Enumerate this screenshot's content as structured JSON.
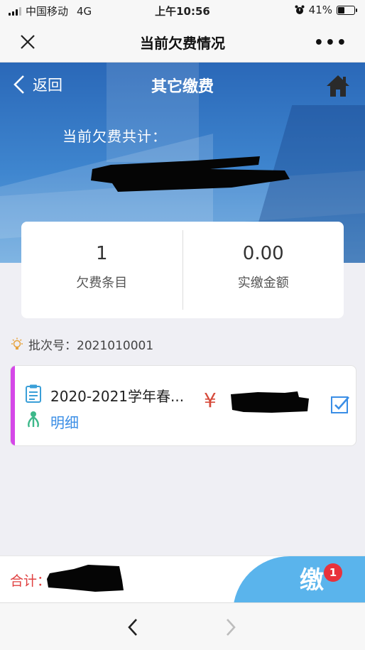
{
  "status_bar": {
    "carrier": "中国移动",
    "network": "4G",
    "time": "上午10:56",
    "battery_percent": "41%",
    "battery_level": 0.41
  },
  "wechat_nav": {
    "title": "当前欠费情况",
    "more_label": "•••",
    "close_icon": "close-icon",
    "more_icon": "more-dots-icon"
  },
  "header": {
    "back_label": "返回",
    "title": "其它缴费",
    "home_icon": "home-icon",
    "owed_label": "当前欠费共计："
  },
  "stats": {
    "count_value": "1",
    "count_label": "欠费条目",
    "paid_value": "0.00",
    "paid_label": "实缴金额"
  },
  "batch": {
    "label": "批次号：2021010001",
    "icon": "bulb-icon"
  },
  "items": [
    {
      "name": "2020-2021学年春...",
      "detail_label": "明细",
      "currency": "¥",
      "checked": true,
      "accent": "#d548e8"
    }
  ],
  "footer": {
    "total_label": "合计：",
    "pay_glyph": "缴",
    "pay_badge": "1"
  },
  "colors": {
    "accent_blue": "#3a8ee6",
    "total_red": "#e04040",
    "pay_button": "#5ab4ec",
    "badge_red": "#e8323c"
  }
}
